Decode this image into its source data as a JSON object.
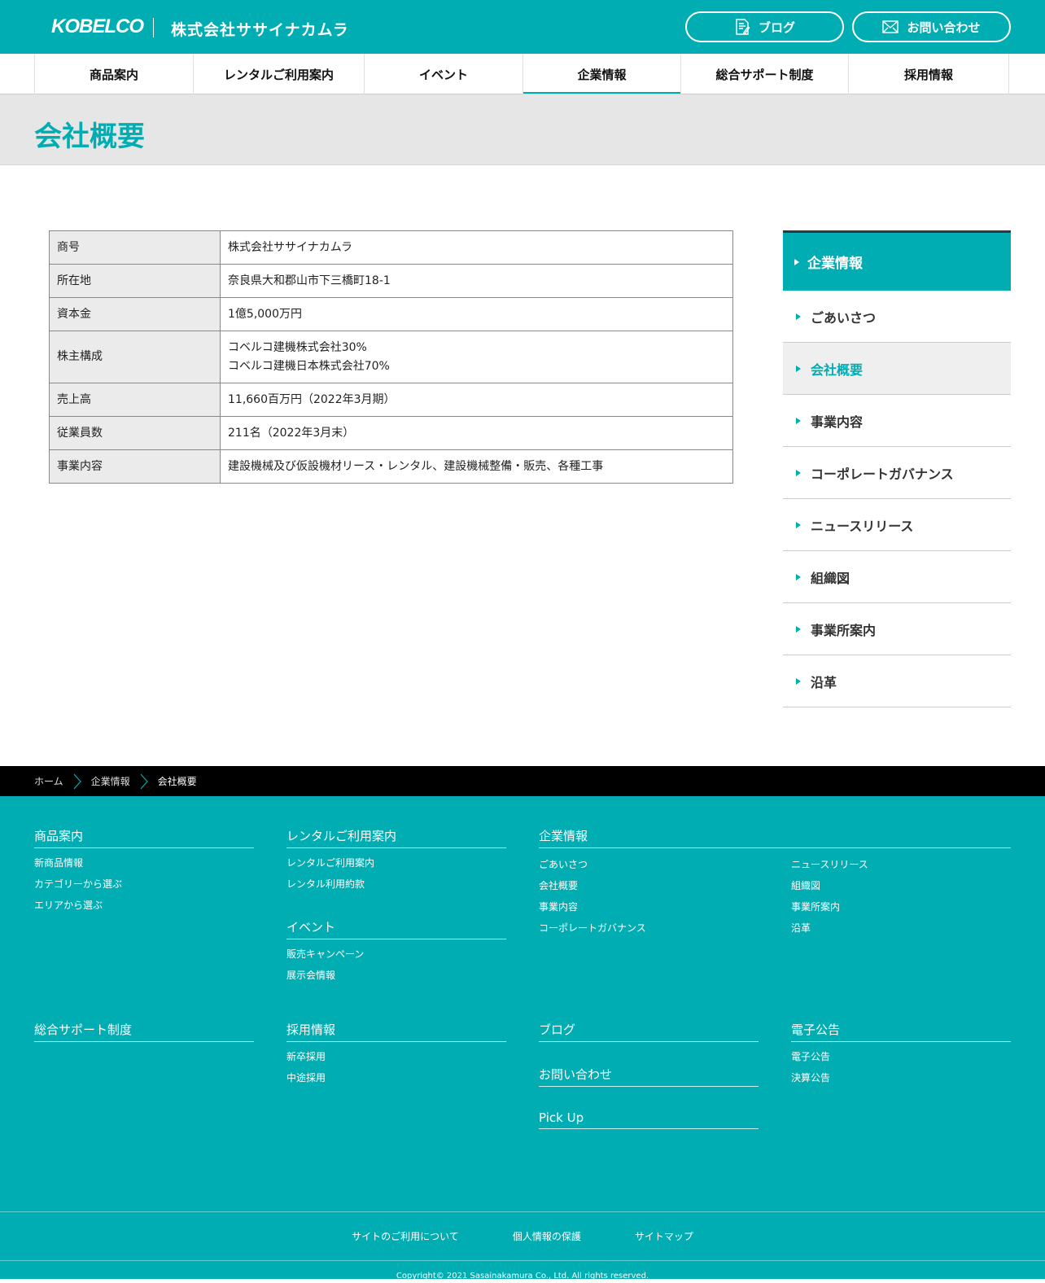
{
  "header": {
    "brand": "KOBELCO",
    "company": "株式会社ササイナカムラ",
    "blog_label": "ブログ",
    "contact_label": "お問い合わせ"
  },
  "gnav": {
    "items": [
      "商品案内",
      "レンタルご利用案内",
      "イベント",
      "企業情報",
      "総合サポート制度",
      "採用情報"
    ],
    "active": "企業情報"
  },
  "page_title": "会社概要",
  "company_table": [
    {
      "label": "商号",
      "value": "株式会社ササイナカムラ"
    },
    {
      "label": "所在地",
      "value": "奈良県大和郡山市下三橋町18-1"
    },
    {
      "label": "資本金",
      "value": "1億5,000万円"
    },
    {
      "label": "株主構成",
      "value": "コベルコ建機株式会社30%",
      "value2": "コベルコ建機日本株式会社70%"
    },
    {
      "label": "売上高",
      "value": "11,660百万円（2022年3月期）"
    },
    {
      "label": "従業員数",
      "value": "211名（2022年3月末）"
    },
    {
      "label": "事業内容",
      "value": "建設機械及び仮設機材リース・レンタル、建設機械整備・販売、各種工事"
    }
  ],
  "sidebar": {
    "head": "企業情報",
    "items": [
      "ごあいさつ",
      "会社概要",
      "事業内容",
      "コーポレートガバナンス",
      "ニュースリリース",
      "組織図",
      "事業所案内",
      "沿革"
    ],
    "active": "会社概要"
  },
  "breadcrumb": [
    "ホーム",
    "企業情報",
    "会社概要"
  ],
  "footer": {
    "products": {
      "head": "商品案内",
      "links": [
        "新商品情報",
        "カテゴリーから選ぶ",
        "エリアから選ぶ"
      ]
    },
    "rental": {
      "head": "レンタルご利用案内",
      "links": [
        "レンタルご利用案内",
        "レンタル利用約款"
      ]
    },
    "event": {
      "head": "イベント",
      "links": [
        "販売キャンペーン",
        "展示会情報"
      ]
    },
    "corp": {
      "head": "企業情報",
      "links_left": [
        "ごあいさつ",
        "会社概要",
        "事業内容",
        "コーポレートガバナンス"
      ],
      "links_right": [
        "ニュースリリース",
        "組織図",
        "事業所案内",
        "沿革"
      ]
    },
    "support": {
      "head": "総合サポート制度"
    },
    "recruit": {
      "head": "採用情報",
      "links": [
        "新卒採用",
        "中途採用"
      ]
    },
    "blog": {
      "head": "ブログ"
    },
    "contact": {
      "head": "お問い合わせ"
    },
    "pickup": {
      "head": "Pick Up"
    },
    "epublic": {
      "head": "電子公告",
      "links": [
        "電子公告",
        "決算公告"
      ]
    },
    "legal": [
      "サイトのご利用について",
      "個人情報の保護",
      "サイトマップ"
    ],
    "copyright": "Copyright© 2021 Sasainakamura Co., Ltd. All rights reserved."
  }
}
